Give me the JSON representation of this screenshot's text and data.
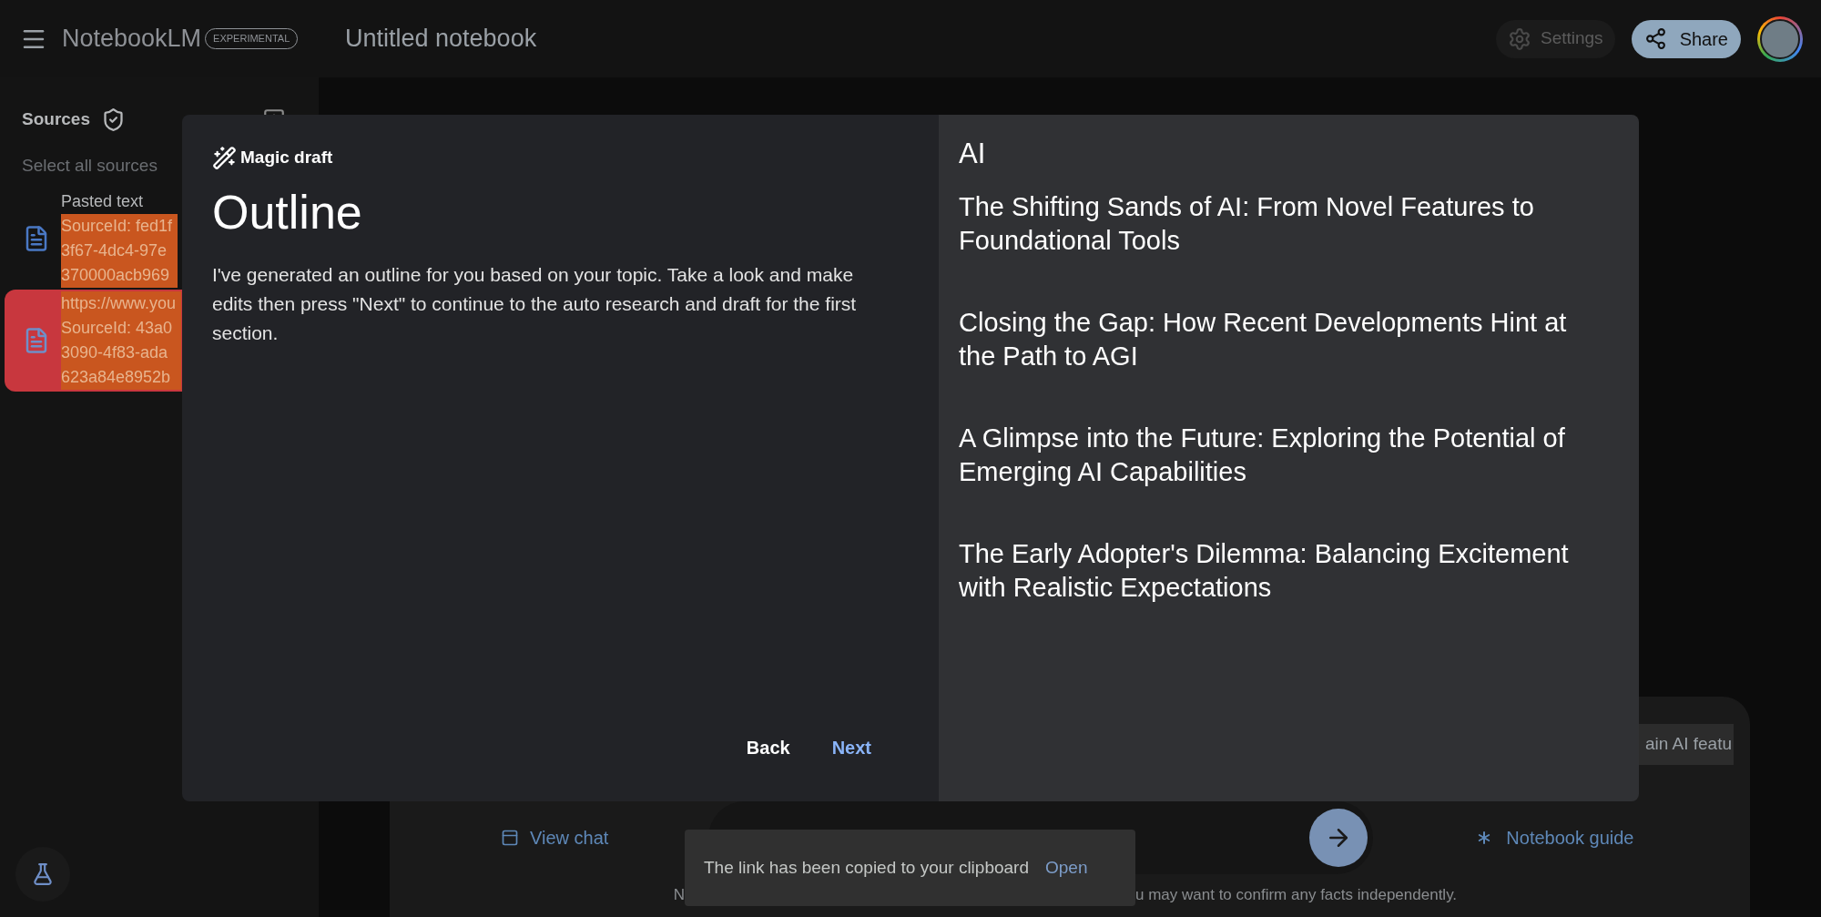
{
  "header": {
    "app_name": "NotebookLM",
    "badge": "EXPERIMENTAL",
    "notebook_title": "Untitled notebook",
    "settings_label": "Settings",
    "share_label": "Share"
  },
  "sidebar": {
    "title": "Sources",
    "select_all": "Select all sources",
    "sources": [
      {
        "kind": "text",
        "title": "Pasted text",
        "lines": [
          "SourceId: fed1f",
          "3f67-4dc4-97e",
          "370000acb969"
        ],
        "selected": false
      },
      {
        "kind": "web",
        "title": "https://www.you",
        "lines": [
          "SourceId: 43a0",
          "3090-4f83-ada",
          "623a84e8952b"
        ],
        "selected": true
      }
    ]
  },
  "modal": {
    "label": "Magic draft",
    "title": "Outline",
    "message": "I've generated an outline for you based on your topic. Take a look and make edits then press \"Next\" to continue to the auto research and draft for the first section.",
    "buttons": [
      {
        "label": "Back",
        "kind": "plain"
      },
      {
        "label": "Next",
        "kind": "primary"
      }
    ],
    "topic": "AI",
    "outline": [
      "The Shifting Sands of AI: From Novel Features to Foundational Tools",
      "Closing the Gap: How Recent Developments Hint at the Path to AGI",
      "A Glimpse into the Future: Exploring the Potential of Emerging AI Capabilities",
      "The Early Adopter's Dilemma: Balancing Excitement with Realistic Expectations"
    ]
  },
  "chat": {
    "suggestion": "ain AI featu",
    "view_chat": "View chat",
    "notebook_guide": "Notebook guide",
    "disclaimer_start": "N",
    "disclaimer_end": "u may want to confirm any facts independently."
  },
  "toast": {
    "message": "The link has been copied to your clipboard",
    "action": "Open"
  }
}
